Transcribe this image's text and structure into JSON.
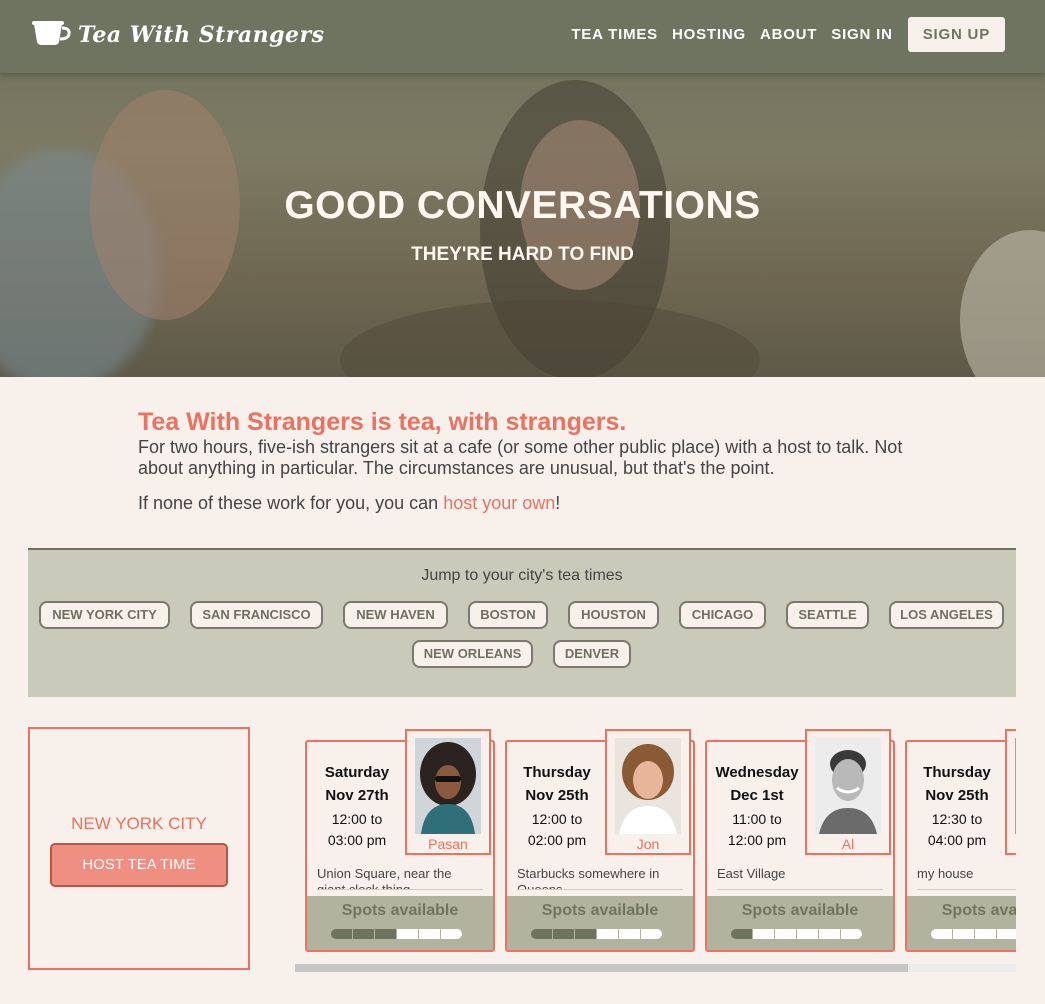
{
  "app": {
    "logo_text": "Tea With Strangers"
  },
  "nav": {
    "items": [
      "TEA TIMES",
      "HOSTING",
      "ABOUT",
      "SIGN IN"
    ],
    "signup": "SIGN UP"
  },
  "hero": {
    "title": "GOOD CONVERSATIONS",
    "subtitle": "THEY'RE HARD TO FIND"
  },
  "intro": {
    "heading": "Tea With Strangers is tea, with strangers.",
    "body": "For two hours, five-ish strangers sit at a cafe (or some other public place) with a host to talk. Not about anything in particular. The circumstances are unusual, but that's the point.",
    "host_prefix": "If none of these work for you, you can ",
    "host_link": "host your own",
    "host_suffix": "!"
  },
  "cities": {
    "jump_label": "Jump to your city's tea times",
    "items": [
      "NEW YORK CITY",
      "SAN FRANCISCO",
      "NEW HAVEN",
      "BOSTON",
      "HOUSTON",
      "CHICAGO",
      "SEATTLE",
      "LOS ANGELES",
      "NEW ORLEANS",
      "DENVER"
    ]
  },
  "city_panel": {
    "name": "NEW YORK CITY",
    "host_button": "HOST TEA TIME"
  },
  "colors": {
    "accent": "#ec7160",
    "olive": "#6f7461",
    "spot_filled": "#6f7461",
    "spot_empty": "#ffffff"
  },
  "tea_times": [
    {
      "day": "Saturday",
      "date": "Nov 27th",
      "start": "12:00 to",
      "end": "03:00 pm",
      "location": "Union Square, near the giant clock thing",
      "host": "Pasan",
      "spots_label": "Spots available",
      "spots_taken": 3,
      "spots_total": 6
    },
    {
      "day": "Thursday",
      "date": "Nov 25th",
      "start": "12:00 to",
      "end": "02:00 pm",
      "location": "Starbucks somewhere in Queens",
      "host": "Jon",
      "spots_label": "Spots available",
      "spots_taken": 3,
      "spots_total": 6
    },
    {
      "day": "Wednesday",
      "date": "Dec 1st",
      "start": "11:00 to",
      "end": "12:00 pm",
      "location": "East Village",
      "host": "Al",
      "spots_label": "Spots available",
      "spots_taken": 1,
      "spots_total": 6
    },
    {
      "day": "Thursday",
      "date": "Nov 25th",
      "start": "12:30 to",
      "end": "04:00 pm",
      "location": "my house",
      "host": "",
      "spots_label": "Spots available",
      "spots_taken": 0,
      "spots_total": 6
    }
  ]
}
